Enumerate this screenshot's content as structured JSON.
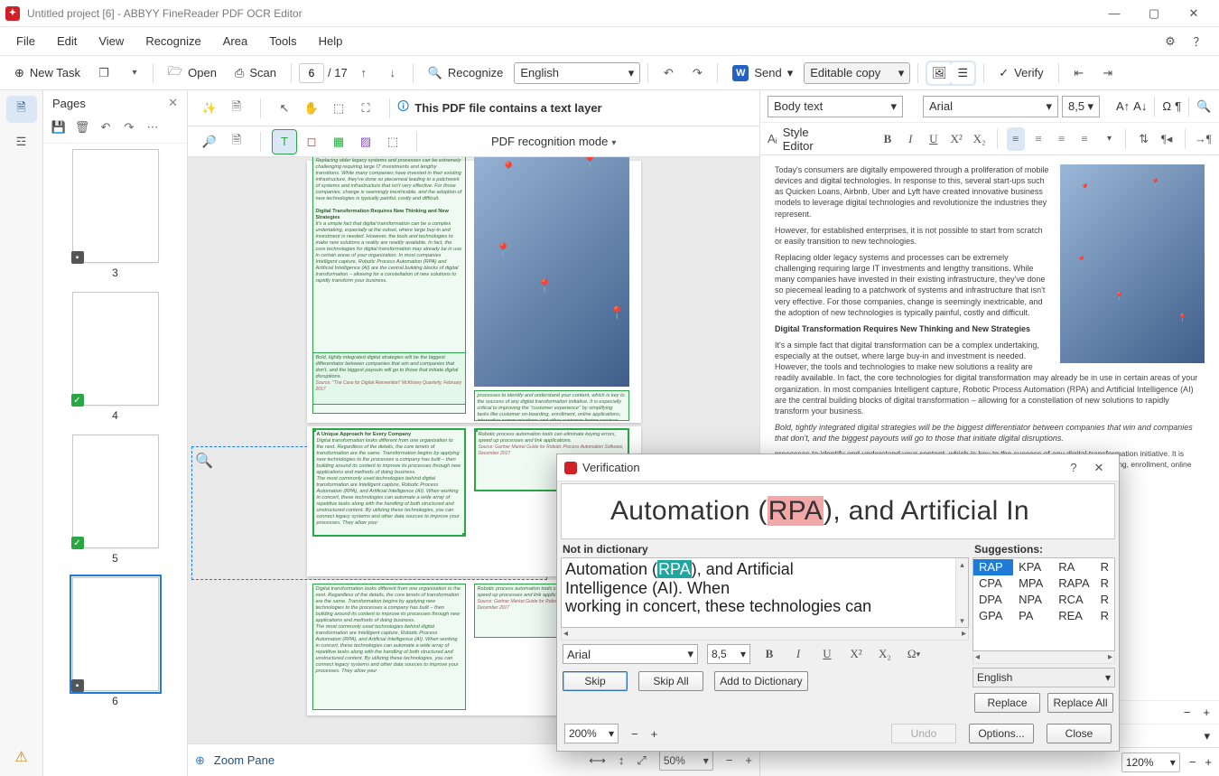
{
  "window": {
    "title": "Untitled project [6] - ABBYY FineReader PDF OCR Editor"
  },
  "menu": {
    "file": "File",
    "edit": "Edit",
    "view": "View",
    "recognize": "Recognize",
    "area": "Area",
    "tools": "Tools",
    "help": "Help"
  },
  "toolbar": {
    "new_task": "New Task",
    "open": "Open",
    "scan": "Scan",
    "page_current": "6",
    "page_total": "/ 17",
    "recognize": "Recognize",
    "language": "English",
    "send": "Send",
    "editable_copy": "Editable copy",
    "verify": "Verify"
  },
  "left_panel": {
    "title": "Pages"
  },
  "pages": {
    "p3": "3",
    "p4": "4",
    "p5": "5",
    "p6": "6"
  },
  "center": {
    "info_msg": "This PDF file contains a text layer",
    "pdf_mode": "PDF recognition mode",
    "zoom_pane": "Zoom Pane",
    "zoom_value": "50%"
  },
  "editor": {
    "style_select": "Body text",
    "font": "Arial",
    "font_size": "8,5",
    "style_editor": "Style Editor"
  },
  "right_zoom": "120%",
  "doc_text": {
    "p1": "Today's consumers are digitally empowered through a proliferation of mobile devices and digital technologies. In response to this, several start-ups such as Quicken Loans, Airbnb, Uber and Lyft have created innovative business models to leverage digital technologies and revolutionize the industries they represent.",
    "p2": "However, for established enterprises, it is not possible to start from scratch or easily transition to new technologies.",
    "p3": "Replacing older legacy systems and processes can be extremely challenging requiring large IT investments and lengthy transitions. While many companies have invested in their existing infrastructure, they've done so piecemeal leading to a patchwork of systems and infrastructure that isn't very effective. For those companies, change is seemingly inextricable, and the adoption of new technologies is typically painful, costly and difficult.",
    "h1": "Digital Transformation Requires New Thinking and New Strategies",
    "p4": "It's a simple fact that digital transformation can be a complex undertaking, especially at the outset, where large buy-in and investment is needed. However, the tools and technologies to make new solutions a reality are readily available. In fact, the core technologies for digital transformation may already be in use in certain areas of your organization. In most companies Intelligent capture, Robotic Process Automation (RPA) and Artificial Intelligence (AI) are the central building blocks of digital transformation – allowing for a constellation of new solutions to rapidly transform your business.",
    "p5": "Bold, tightly integrated digital strategies will be the biggest differentiator between companies that win and companies that don't, and the biggest payouts will go to those that initiate digital disruptions.",
    "src1": "Source: \"The Case for Digital Reinvention\" McKinsey Quarterly, February 2017",
    "h2": "A Unique Approach for Every Company",
    "p6": "Digital transformation looks different from one organization to the next. Regardless of the details, the core tenets of transformation are the same. Transformation begins by applying new technologies to the processes a company has built – then building around its content to improve its processes through new applications and methods of doing business.",
    "p7": "The most commonly used technologies behind digital transformation are Intelligent capture, Robotic Process Automation (RPA), and Artificial Intelligence (AI). When working in concert, these technologies can automate a wide array of repetitive tasks along with the handling of both structured and unstructured content. By utilizing these technologies, you can connect legacy systems and other data sources to improve your processes. They allow your",
    "p8": "processes to identify and understand your content, which is key to the success of any digital transformation initiative. It is especially critical to improving the \"customer experience\" by simplifying tasks like customer on-boarding, enrollment, online applications, interactive communications and other customer-facing services.",
    "p9": "Robotic process automation tools can eliminate keying errors, speed up processes and link applications.",
    "src2": "Source: Gartner Market Guide for Robotic Process Automation Software, December 2017"
  },
  "verify": {
    "title": "Verification",
    "preview_before": "Automation (",
    "preview_hl": "RPA",
    "preview_after": "), and Artificial In",
    "not_in_dict": "Not in dictionary",
    "text_line1_a": "Automation (",
    "text_line1_b": "RPA",
    "text_line1_c": "), and Artificial",
    "text_line2": "Intelligence (AI). When",
    "text_line3": "working in concert, these technologies can",
    "font": "Arial",
    "size": "8,5",
    "skip": "Skip",
    "skip_all": "Skip All",
    "add_dict": "Add to Dictionary",
    "sugg_label": "Suggestions:",
    "sugg": {
      "c1": [
        "RAP",
        "CPA",
        "DPA",
        "GPA"
      ],
      "c2": [
        "KPA",
        "MPA",
        "NPA",
        "PA"
      ],
      "c3": [
        "RA",
        "RAPA",
        "RCA",
        "REA"
      ],
      "c4": [
        "R",
        "R",
        "R",
        "R"
      ]
    },
    "lang": "English",
    "replace": "Replace",
    "replace_all": "Replace All",
    "zoom": "200%",
    "undo": "Undo",
    "options": "Options...",
    "close": "Close"
  }
}
